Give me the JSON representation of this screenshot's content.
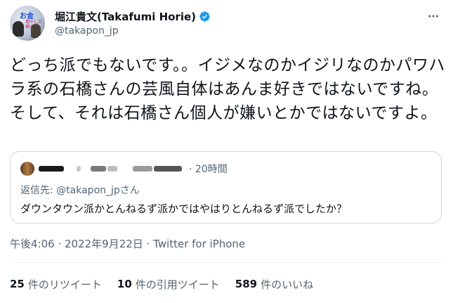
{
  "author": {
    "display_name": "堀江貴文(Takafumi Horie)",
    "handle": "@takapon_jp",
    "avatar_text": "お金",
    "avatar_subtext": "増やし方 稼ぎ方",
    "avatar_icon": "profile-avatar",
    "verified_icon": "verified-badge-icon",
    "more_icon": "more-options-icon",
    "accent_color": "#1d9bf0"
  },
  "tweet": {
    "text": "どっち派でもないです。。イジメなのかイジリなのかパワハラ系の石橋さんの芸風自体はあんま好きではないですね。そして、それは石橋さん個人が嫌いとかではないですよ。",
    "timestamp": "午後4:06 · 2022年9月22日 · Twitter for iPhone"
  },
  "quote": {
    "time": "· 20時間",
    "reply_prefix": "返信先: ",
    "reply_handle": "@takapon_jpさん",
    "body": "ダウンタウン派かとんねるず派かではやはりとんねるず派でしたか？"
  },
  "stats": [
    {
      "num": "25",
      "label": "件のリツイート"
    },
    {
      "num": "10",
      "label": "件の引用ツイート"
    },
    {
      "num": "589",
      "label": "件のいいね"
    }
  ]
}
